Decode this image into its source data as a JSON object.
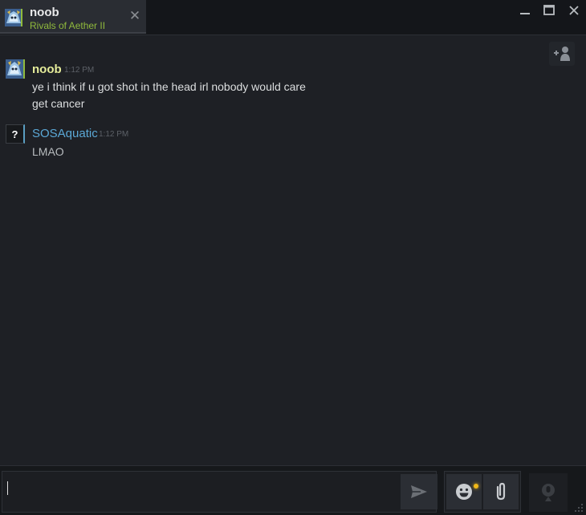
{
  "tab": {
    "name": "noob",
    "game": "Rivals of Aether II",
    "close_symbol": "✕"
  },
  "window_controls": {
    "minimize": "minimize-icon",
    "maximize": "maximize-icon",
    "close": "close-icon"
  },
  "messages": [
    {
      "sender": "noob",
      "status": "in-game",
      "time": "1:12 PM",
      "lines": [
        "ye i think if u got shot in the head irl nobody would care",
        "get cancer"
      ]
    },
    {
      "sender": "SOSAquatic",
      "status": "online",
      "time": "1:12 PM",
      "avatar_glyph": "?",
      "lines": [
        "LMAO"
      ]
    }
  ],
  "input": {
    "value": "",
    "placeholder": ""
  },
  "colors": {
    "in_game": "#90ba3c",
    "in_game_name": "#e5ec9a",
    "online": "#5ba8d6",
    "notification": "#f0b818"
  }
}
